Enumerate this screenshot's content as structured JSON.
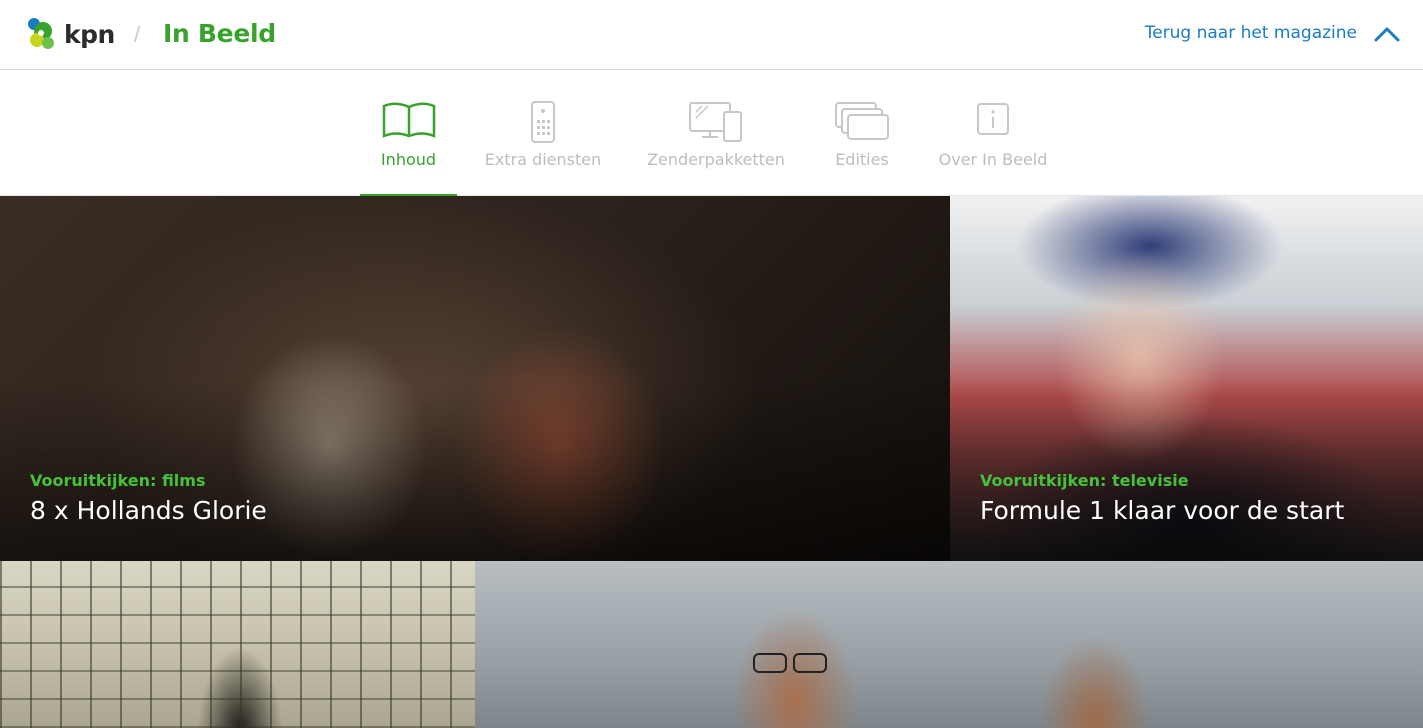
{
  "header": {
    "logo_text": "kpn",
    "separator": "/",
    "title": "In Beeld",
    "back_link": "Terug naar het magazine"
  },
  "tabs": [
    {
      "label": "Inhoud",
      "icon": "book-icon",
      "active": true
    },
    {
      "label": "Extra diensten",
      "icon": "remote-control-icon",
      "active": false
    },
    {
      "label": "Zenderpakketten",
      "icon": "devices-icon",
      "active": false
    },
    {
      "label": "Edities",
      "icon": "stacked-screens-icon",
      "active": false
    },
    {
      "label": "Over In Beeld",
      "icon": "info-icon",
      "active": false
    }
  ],
  "tiles": [
    {
      "category": "Vooruitkijken: films",
      "title": "8 x Hollands Glorie"
    },
    {
      "category": "Vooruitkijken: televisie",
      "title": "Formule 1 klaar voor de start"
    }
  ],
  "colors": {
    "brand_green": "#37a32d",
    "link_blue": "#1a7cc6",
    "inactive_gray": "#bdbdbd"
  }
}
